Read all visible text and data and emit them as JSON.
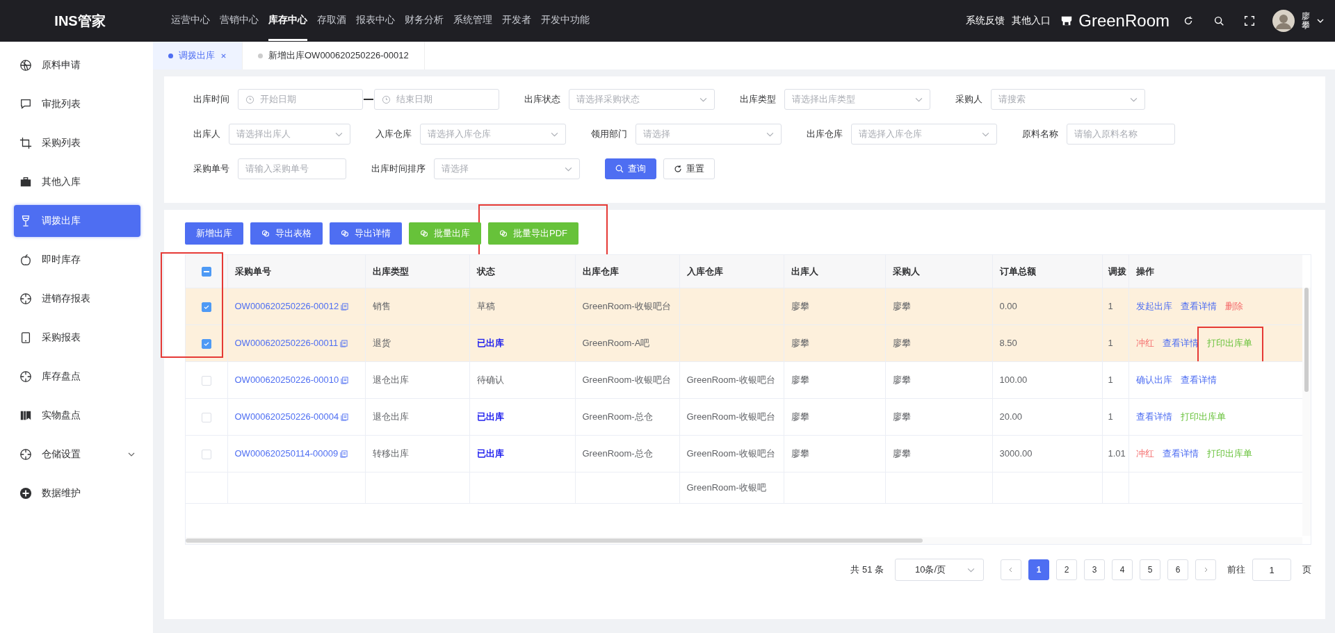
{
  "app": {
    "logo": "INS管家"
  },
  "nav": [
    {
      "label": "运营中心",
      "selected": false
    },
    {
      "label": "营销中心",
      "selected": false
    },
    {
      "label": "库存中心",
      "selected": true
    },
    {
      "label": "存取酒",
      "selected": false
    },
    {
      "label": "报表中心",
      "selected": false
    },
    {
      "label": "财务分析",
      "selected": false
    },
    {
      "label": "系统管理",
      "selected": false
    },
    {
      "label": "开发者",
      "selected": false
    },
    {
      "label": "开发中功能",
      "selected": false
    }
  ],
  "header_right": {
    "links": [
      "系统反馈",
      "其他入口"
    ],
    "store": "GreenRoom",
    "user": "廖攀"
  },
  "sidebar": {
    "items": [
      {
        "label": "原料申请",
        "selected": false,
        "kind": "link"
      },
      {
        "label": "审批列表",
        "selected": false,
        "kind": "link"
      },
      {
        "label": "采购列表",
        "selected": false,
        "kind": "link"
      },
      {
        "label": "其他入库",
        "selected": false,
        "kind": "link"
      },
      {
        "label": "调拨出库",
        "selected": true,
        "kind": "link"
      },
      {
        "label": "即时库存",
        "selected": false,
        "kind": "link"
      },
      {
        "label": "进销存报表",
        "selected": false,
        "kind": "link"
      },
      {
        "label": "采购报表",
        "selected": false,
        "kind": "link"
      },
      {
        "label": "库存盘点",
        "selected": false,
        "kind": "link"
      },
      {
        "label": "实物盘点",
        "selected": false,
        "kind": "link"
      },
      {
        "label": "仓储设置",
        "selected": false,
        "kind": "group",
        "expanded": false
      },
      {
        "label": "数据维护",
        "selected": false,
        "kind": "link"
      }
    ]
  },
  "tabs": [
    {
      "label": "调拨出库",
      "selected": true,
      "closable": true
    },
    {
      "label": "新增出库OW000620250226-00012",
      "selected": false,
      "closable": false
    }
  ],
  "filters": [
    [
      {
        "label": "出库时间",
        "kind": "daterange",
        "placeholder": "开始日期",
        "placeholder_end": "结束日期"
      },
      {
        "label": "出库状态",
        "kind": "select",
        "placeholder": "请选择采购状态"
      },
      {
        "label": "出库类型",
        "kind": "select",
        "placeholder": "请选择出库类型"
      },
      {
        "label": "采购人",
        "kind": "select",
        "placeholder": "请搜索"
      }
    ],
    [
      {
        "label": "出库人",
        "kind": "select",
        "placeholder": "请选择出库人"
      },
      {
        "label": "入库仓库",
        "kind": "select",
        "placeholder": "请选择入库仓库"
      },
      {
        "label": "领用部门",
        "kind": "select",
        "placeholder": "请选择"
      },
      {
        "label": "出库仓库",
        "kind": "select",
        "placeholder": "请选择入库仓库"
      },
      {
        "label": "原料名称",
        "kind": "input",
        "placeholder": "请输入原料名称"
      }
    ],
    [
      {
        "label": "采购单号",
        "kind": "input",
        "placeholder": "请输入采购单号"
      },
      {
        "label": "出库时间排序",
        "kind": "select",
        "placeholder": "请选择"
      }
    ]
  ],
  "filter_buttons": [
    {
      "label": "查询",
      "kind": "primary"
    },
    {
      "label": "重置",
      "kind": "default"
    }
  ],
  "toolbar": [
    {
      "label": "新增出库",
      "kind": "primary",
      "icon": false,
      "highlighted": false
    },
    {
      "label": "导出表格",
      "kind": "primary",
      "icon": true,
      "highlighted": false
    },
    {
      "label": "导出详情",
      "kind": "primary",
      "icon": true,
      "highlighted": false
    },
    {
      "label": "批量出库",
      "kind": "success",
      "icon": true,
      "highlighted": false
    },
    {
      "label": "批量导出PDF",
      "kind": "success",
      "icon": true,
      "highlighted": true
    }
  ],
  "table": {
    "select_all_indeterminate": true,
    "selection_highlighted": true,
    "columns": [
      "采购单号",
      "出库类型",
      "状态",
      "出库仓库",
      "入库仓库",
      "出库人",
      "采购人",
      "订单总额",
      "调拨",
      "操作"
    ],
    "rows": [
      {
        "selected": true,
        "order_no": "OW000620250226-00012",
        "type": "销售",
        "status": {
          "text": "草稿",
          "color": "#606266"
        },
        "out_wh": "GreenRoom-收银吧台",
        "out_person": "廖攀",
        "buyer": "廖攀",
        "total": "0.00",
        "column_10": "1",
        "actions": [
          {
            "text": "发起出库",
            "kind": "primary",
            "highlighted": false
          },
          {
            "text": "查看详情",
            "kind": "primary",
            "highlighted": false
          },
          {
            "text": "删除",
            "kind": "danger",
            "highlighted": false
          }
        ]
      },
      {
        "selected": true,
        "order_no": "OW000620250226-00011",
        "type": "退货",
        "status": {
          "text": "已出库",
          "color": "#1a1aee"
        },
        "out_wh": "GreenRoom-A吧",
        "out_person": "廖攀",
        "buyer": "廖攀",
        "total": "8.50",
        "column_10": "1",
        "actions": [
          {
            "text": "冲红",
            "kind": "danger",
            "highlighted": false
          },
          {
            "text": "查看详情",
            "kind": "primary",
            "highlighted": false
          },
          {
            "text": "打印出库单",
            "kind": "success",
            "highlighted": true
          }
        ]
      },
      {
        "selected": false,
        "order_no": "OW000620250226-00010",
        "type": "退仓出库",
        "status": {
          "text": "待确认",
          "color": "#606266"
        },
        "out_wh": "GreenRoom-收银吧台",
        "in_wh": "GreenRoom-收银吧台",
        "out_person": "廖攀",
        "buyer": "廖攀",
        "total": "100.00",
        "column_10": "1",
        "actions": [
          {
            "text": "确认出库",
            "kind": "primary",
            "highlighted": false
          },
          {
            "text": "查看详情",
            "kind": "primary",
            "highlighted": false
          }
        ]
      },
      {
        "selected": false,
        "order_no": "OW000620250226-00004",
        "type": "退仓出库",
        "status": {
          "text": "已出库",
          "color": "#1a1aee"
        },
        "out_wh": "GreenRoom-总仓",
        "in_wh": "GreenRoom-收银吧台",
        "out_person": "廖攀",
        "buyer": "廖攀",
        "total": "20.00",
        "column_10": "1",
        "actions": [
          {
            "text": "查看详情",
            "kind": "primary",
            "highlighted": false
          },
          {
            "text": "打印出库单",
            "kind": "success",
            "highlighted": false
          }
        ]
      },
      {
        "selected": false,
        "order_no": "OW000620250114-00009",
        "type": "转移出库",
        "status": {
          "text": "已出库",
          "color": "#1a1aee"
        },
        "out_wh": "GreenRoom-总仓",
        "in_wh": "GreenRoom-收银吧台",
        "out_person": "廖攀",
        "buyer": "廖攀",
        "total": "3000.00",
        "column_10": "1.01",
        "actions": [
          {
            "text": "冲红",
            "kind": "danger",
            "highlighted": false
          },
          {
            "text": "查看详情",
            "kind": "primary",
            "highlighted": false
          },
          {
            "text": "打印出库单",
            "kind": "success",
            "highlighted": false
          }
        ]
      },
      {
        "in_wh": "GreenRoom-收银吧"
      }
    ]
  },
  "pagination": {
    "total": "共 51 条",
    "page_size": "10条/页",
    "pages": [
      {
        "label": "1",
        "selected": true
      },
      {
        "label": "2",
        "selected": false
      },
      {
        "label": "3",
        "selected": false
      },
      {
        "label": "4",
        "selected": false
      },
      {
        "label": "5",
        "selected": false
      },
      {
        "label": "6",
        "selected": false
      }
    ],
    "goto_label": "前往",
    "goto_value": "1",
    "goto_suffix": "页"
  }
}
